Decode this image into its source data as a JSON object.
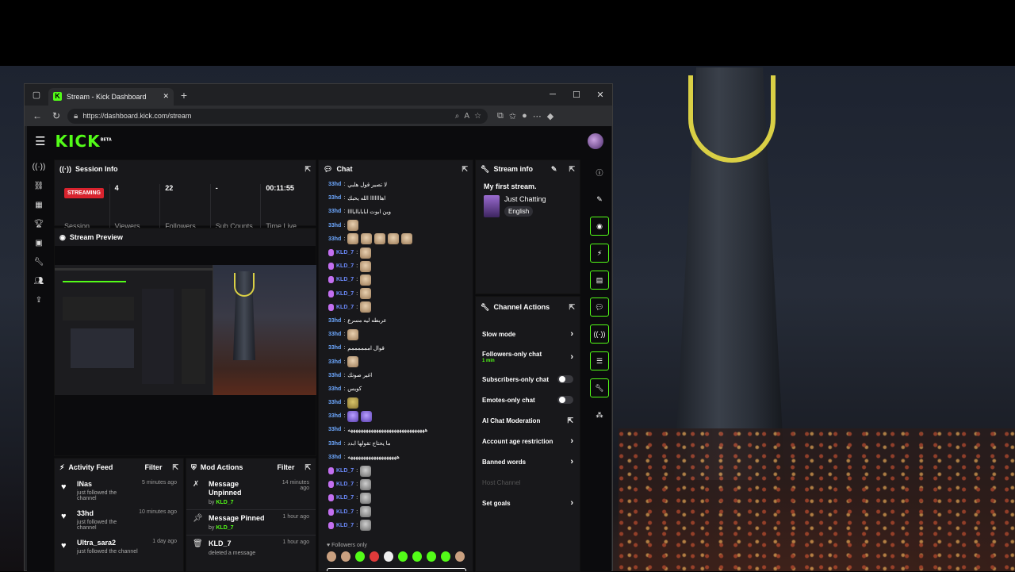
{
  "browser": {
    "tab_title": "Stream - Kick Dashboard",
    "url": "https://dashboard.kick.com/stream",
    "new_tab": "+",
    "controls": {
      "minimize": "─",
      "maximize": "☐",
      "close": "✕"
    }
  },
  "header": {
    "logo": "KICK",
    "logo_tag": "BETA"
  },
  "session_info": {
    "title": "Session Info",
    "stats": [
      {
        "value": "STREAMING",
        "label": "Session"
      },
      {
        "value": "4",
        "label": "Viewers"
      },
      {
        "value": "22",
        "label": "Followers"
      },
      {
        "value": "-",
        "label": "Sub Counts"
      },
      {
        "value": "00:11:55",
        "label": "Time Live"
      }
    ]
  },
  "stream_preview": {
    "title": "Stream Preview"
  },
  "activity_feed": {
    "title": "Activity Feed",
    "filter": "Filter",
    "items": [
      {
        "name": "INas",
        "sub": "just followed the channel",
        "time": "5 minutes ago"
      },
      {
        "name": "33hd",
        "sub": "just followed the channel",
        "time": "10 minutes ago"
      },
      {
        "name": "Ultra_sara2",
        "sub": "just followed the channel",
        "time": "1 day ago"
      }
    ]
  },
  "mod_actions": {
    "title": "Mod Actions",
    "filter": "Filter",
    "items": [
      {
        "title": "Message Unpinned",
        "by_prefix": "by",
        "by": "KLD_7",
        "time": "14 minutes ago"
      },
      {
        "title": "Message Pinned",
        "by_prefix": "by",
        "by": "KLD_7",
        "time": "1 hour ago"
      },
      {
        "title": "KLD_7",
        "by_prefix": "deleted a message",
        "by": "",
        "time": "1 hour ago"
      }
    ]
  },
  "chat": {
    "title": "Chat",
    "messages": [
      {
        "user": "33hd",
        "text": "لا تصير قول هلبي"
      },
      {
        "user": "33hd",
        "text": "اهااااااا الله يحبك"
      },
      {
        "user": "33hd",
        "text": "وين ابوت ابابابااياااا"
      },
      {
        "user": "33hd",
        "emotes": 1
      },
      {
        "user": "33hd",
        "emotes": 5
      },
      {
        "user": "KLD_7",
        "emotes": 1
      },
      {
        "user": "KLD_7",
        "emotes": 1
      },
      {
        "user": "KLD_7",
        "emotes": 1
      },
      {
        "user": "KLD_7",
        "emotes": 1
      },
      {
        "user": "KLD_7",
        "emotes": 1
      },
      {
        "user": "33hd",
        "text": "عربطه ليه مسرع"
      },
      {
        "user": "33hd",
        "emotes": 1
      },
      {
        "user": "33hd",
        "text": "قوال اممممممم"
      },
      {
        "user": "33hd",
        "emotes": 1
      },
      {
        "user": "33hd",
        "text": "اغير صوتك"
      },
      {
        "user": "33hd",
        "text": "كويس"
      },
      {
        "user": "33hd",
        "emotes": 1,
        "emote_style": "yel"
      },
      {
        "user": "33hd",
        "emotes": 2,
        "emote_style": "pur"
      },
      {
        "user": "33hd",
        "text": "ههههههههههههههههههههههههههههههه"
      },
      {
        "user": "33hd",
        "text": "ما يحتاج تقولها ابدد"
      },
      {
        "user": "33hd",
        "text": "هههههههههههههههههههه"
      },
      {
        "user": "KLD_7",
        "emotes": 1,
        "emote_style": "grey"
      },
      {
        "user": "KLD_7",
        "emotes": 1,
        "emote_style": "grey"
      },
      {
        "user": "KLD_7",
        "emotes": 1,
        "emote_style": "grey"
      },
      {
        "user": "KLD_7",
        "emotes": 1,
        "emote_style": "grey"
      },
      {
        "user": "KLD_7",
        "emotes": 1,
        "emote_style": "grey"
      }
    ],
    "followers_only": "Followers only"
  },
  "stream_info": {
    "title": "Stream info",
    "stream_title": "My first stream.",
    "category": "Just Chatting",
    "language": "English"
  },
  "channel_actions": {
    "title": "Channel Actions",
    "items": [
      {
        "label": "Slow mode",
        "control": "chevron"
      },
      {
        "label": "Followers-only chat",
        "sub": "1 min",
        "control": "chevron"
      },
      {
        "label": "Subscribers-only chat",
        "control": "toggle"
      },
      {
        "label": "Emotes-only chat",
        "control": "toggle"
      },
      {
        "label": "AI Chat Moderation",
        "control": "external"
      },
      {
        "label": "Account age restriction",
        "control": "chevron"
      },
      {
        "label": "Banned words",
        "control": "chevron"
      },
      {
        "label": "Host Channel",
        "control": "disabled"
      },
      {
        "label": "Set goals",
        "control": "chevron"
      }
    ]
  },
  "colors": {
    "brand": "#53fc18",
    "live": "#d9232e",
    "panel": "#18181b"
  }
}
